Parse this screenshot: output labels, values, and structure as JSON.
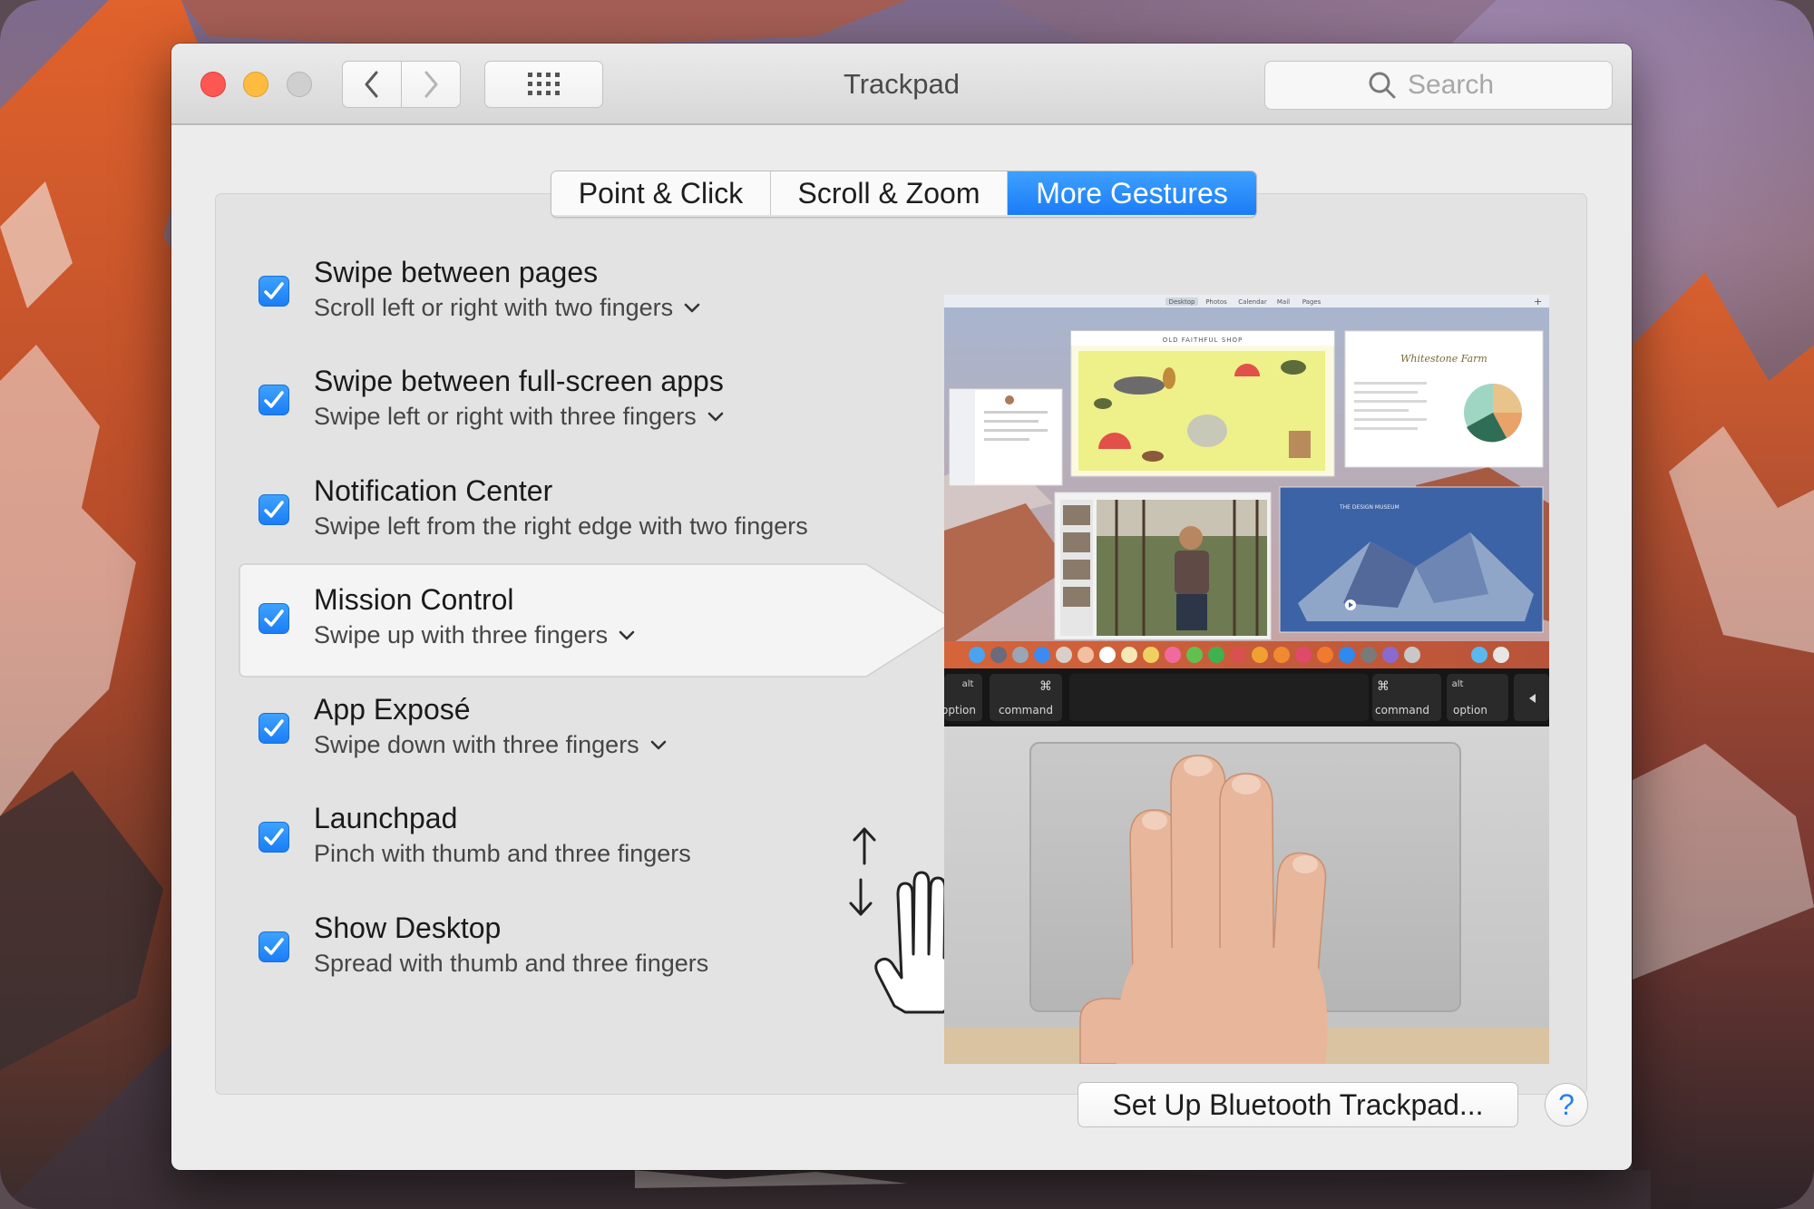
{
  "window": {
    "title": "Trackpad"
  },
  "search": {
    "placeholder": "Search"
  },
  "tabs": [
    {
      "label": "Point & Click",
      "active": false
    },
    {
      "label": "Scroll & Zoom",
      "active": false
    },
    {
      "label": "More Gestures",
      "active": true
    }
  ],
  "gestures": [
    {
      "title": "Swipe between pages",
      "subtitle": "Scroll left or right with two fingers",
      "checked": true,
      "has_menu": true
    },
    {
      "title": "Swipe between full-screen apps",
      "subtitle": "Swipe left or right with three fingers",
      "checked": true,
      "has_menu": true
    },
    {
      "title": "Notification Center",
      "subtitle": "Swipe left from the right edge with two fingers",
      "checked": true,
      "has_menu": false
    },
    {
      "title": "Mission Control",
      "subtitle": "Swipe up with three fingers",
      "checked": true,
      "has_menu": true,
      "selected": true
    },
    {
      "title": "App Exposé",
      "subtitle": "Swipe down with three fingers",
      "checked": true,
      "has_menu": true
    },
    {
      "title": "Launchpad",
      "subtitle": "Pinch with thumb and three fingers",
      "checked": true,
      "has_menu": false
    },
    {
      "title": "Show Desktop",
      "subtitle": "Spread with thumb and three fingers",
      "checked": true,
      "has_menu": false
    }
  ],
  "preview": {
    "touchbar": {
      "left_alt": "alt",
      "left_option": "option",
      "left_command_symbol": "⌘",
      "left_command": "command",
      "right_command_symbol": "⌘",
      "right_command": "command",
      "right_alt": "alt",
      "right_option": "option"
    },
    "windows": {
      "shop_title": "OLD FAITHFUL SHOP",
      "farm_title": "Whitestone Farm",
      "museum_title": "THE DESIGN MUSEUM"
    },
    "menubar_items": [
      "Desktop",
      "Photos",
      "Calendar",
      "Mail",
      "Pages"
    ]
  },
  "footer": {
    "setup_button": "Set Up Bluetooth Trackpad...",
    "help_label": "?"
  },
  "colors": {
    "accent": "#1a7cf5",
    "close": "#fc5753",
    "minimize": "#fdbc40",
    "zoom_disabled": "#cfcfcf"
  }
}
